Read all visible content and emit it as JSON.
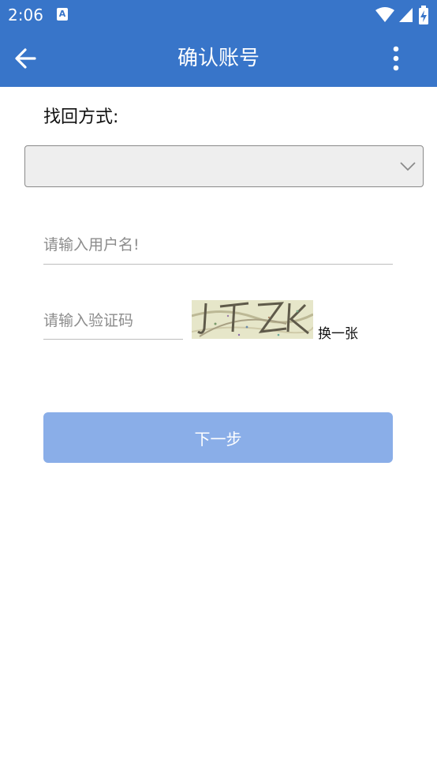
{
  "status_bar": {
    "time": "2:06",
    "notification_icon": "a-letter-icon",
    "icons": [
      "wifi-icon",
      "signal-icon",
      "battery-charging-icon"
    ]
  },
  "app_bar": {
    "title": "确认账号",
    "back_icon": "arrow-left-icon",
    "menu_icon": "more-vert-icon"
  },
  "form": {
    "method_label": "找回方式:",
    "method_select_value": "",
    "username_placeholder": "请输入用户名!",
    "captcha_placeholder": "请输入验证码",
    "captcha_image_text": "JTZK",
    "refresh_label": "换一张",
    "next_label": "下一步"
  },
  "colors": {
    "primary": "#3875c9",
    "button_disabled": "#8aaee8",
    "select_bg": "#eeeeee"
  }
}
